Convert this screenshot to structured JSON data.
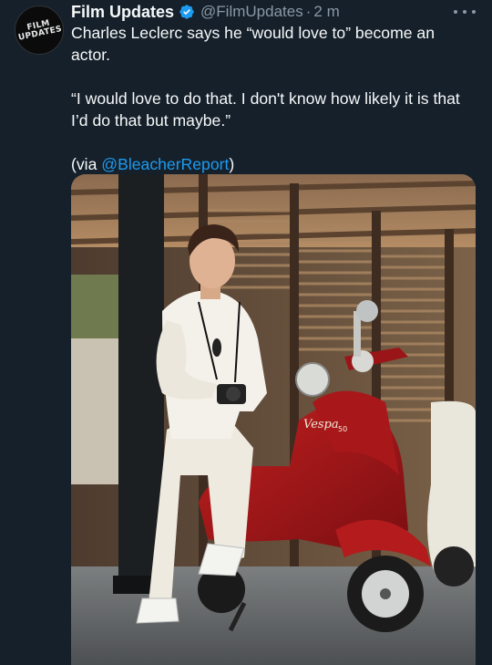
{
  "tweet": {
    "avatar_text_line1": "FILM",
    "avatar_text_line2": "UPDATES",
    "display_name": "Film Updates",
    "handle": "@FilmUpdates",
    "separator": "·",
    "time": "2 m",
    "text_line1": "Charles Leclerc says he “would love to” become an actor.",
    "quote": "“I would love to do that. I don't know how likely it is that I’d do that but maybe.”",
    "via_prefix": "(via ",
    "via_mention": "@BleacherReport",
    "via_suffix": ")",
    "verified_icon": "verified-badge-icon",
    "more_icon": "more-options-icon"
  },
  "media": {
    "scooter_brand": "Vespa",
    "scooter_model": "50",
    "alt": "photo"
  },
  "colors": {
    "background": "#15202b",
    "text": "#f7f9f9",
    "secondary": "#8b98a5",
    "link": "#1d9bf0"
  }
}
